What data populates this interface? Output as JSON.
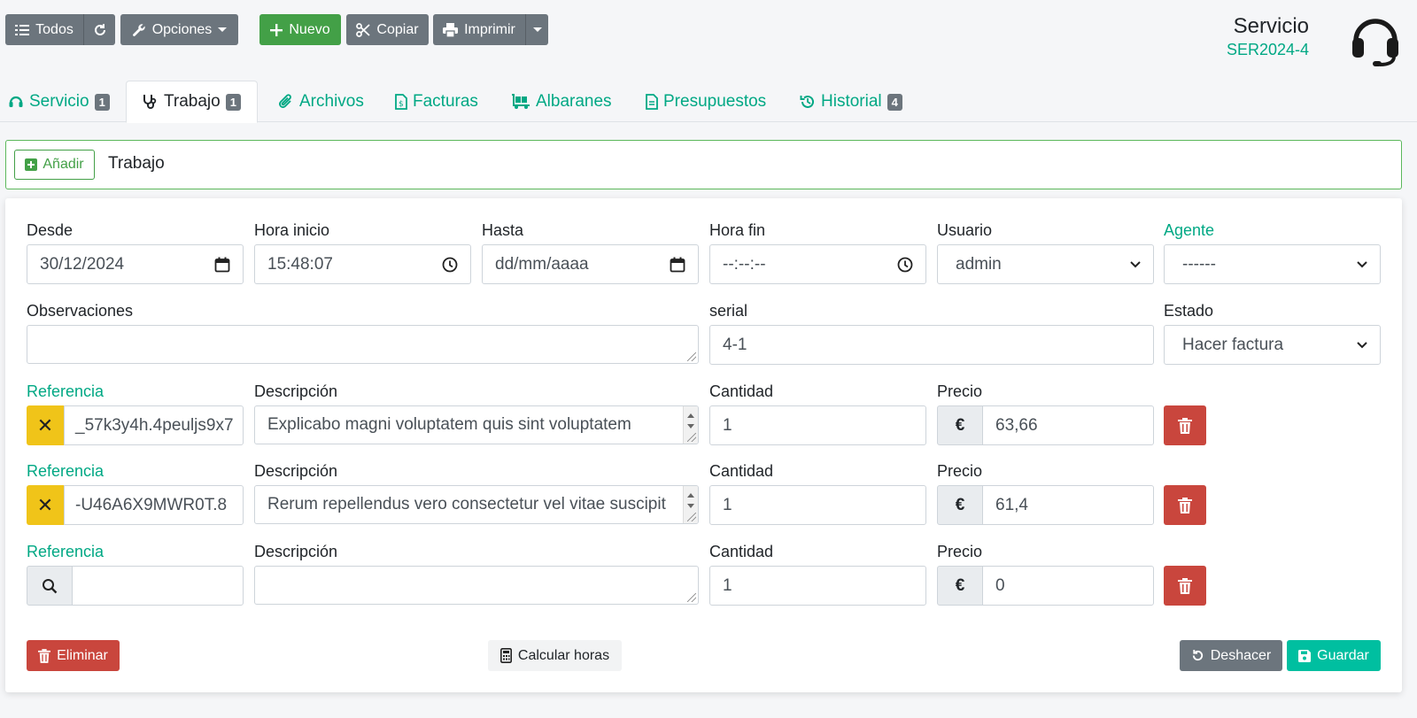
{
  "toolbar": {
    "all_label": "Todos",
    "options_label": "Opciones",
    "new_label": "Nuevo",
    "copy_label": "Copiar",
    "print_label": "Imprimir"
  },
  "header": {
    "title": "Servicio",
    "code": "SER2024-4"
  },
  "tabs": [
    {
      "label": "Servicio",
      "badge": "1",
      "icon": "headset-icon"
    },
    {
      "label": "Trabajo",
      "badge": "1",
      "icon": "stethoscope-icon",
      "active": true
    },
    {
      "label": "Archivos",
      "icon": "paperclip-icon"
    },
    {
      "label": "Facturas",
      "icon": "invoice-icon"
    },
    {
      "label": "Albaranes",
      "icon": "dolly-icon"
    },
    {
      "label": "Presupuestos",
      "icon": "document-icon"
    },
    {
      "label": "Historial",
      "badge": "4",
      "icon": "history-icon"
    }
  ],
  "addbar": {
    "add_label": "Añadir",
    "title": "Trabajo"
  },
  "form": {
    "desde_label": "Desde",
    "desde_value": "30/12/2024",
    "hora_inicio_label": "Hora inicio",
    "hora_inicio_value": "15:48:07",
    "hasta_label": "Hasta",
    "hasta_placeholder": "dd/mm/aaaa",
    "hora_fin_label": "Hora fin",
    "hora_fin_placeholder": "--:--:--",
    "usuario_label": "Usuario",
    "usuario_value": "admin",
    "agente_label": "Agente",
    "agente_value": "------",
    "observaciones_label": "Observaciones",
    "observaciones_value": "",
    "serial_label": "serial",
    "serial_value": "4-1",
    "estado_label": "Estado",
    "estado_value": "Hacer factura"
  },
  "lines": [
    {
      "ref_label": "Referencia",
      "ref_value": "_57k3y4h.4peuljs9x7",
      "desc_label": "Descripción",
      "desc_value": "Explicabo magni voluptatem quis sint voluptatem",
      "qty_label": "Cantidad",
      "qty_value": "1",
      "price_label": "Precio",
      "currency": "€",
      "price_value": "63,66"
    },
    {
      "ref_label": "Referencia",
      "ref_value": "-U46A6X9MWR0T.8",
      "desc_label": "Descripción",
      "desc_value": "Rerum repellendus vero consectetur vel vitae suscipit",
      "qty_label": "Cantidad",
      "qty_value": "1",
      "price_label": "Precio",
      "currency": "€",
      "price_value": "61,4"
    },
    {
      "ref_label": "Referencia",
      "ref_value": "",
      "desc_label": "Descripción",
      "desc_value": "",
      "qty_label": "Cantidad",
      "qty_value": "1",
      "price_label": "Precio",
      "currency": "€",
      "price_value": "0"
    }
  ],
  "footer": {
    "delete_label": "Eliminar",
    "calc_label": "Calcular horas",
    "undo_label": "Deshacer",
    "save_label": "Guardar"
  },
  "colors": {
    "accent": "#00a884",
    "green": "#43a047",
    "danger": "#c9463d",
    "warning": "#f0c419",
    "secondary": "#6c757d"
  }
}
